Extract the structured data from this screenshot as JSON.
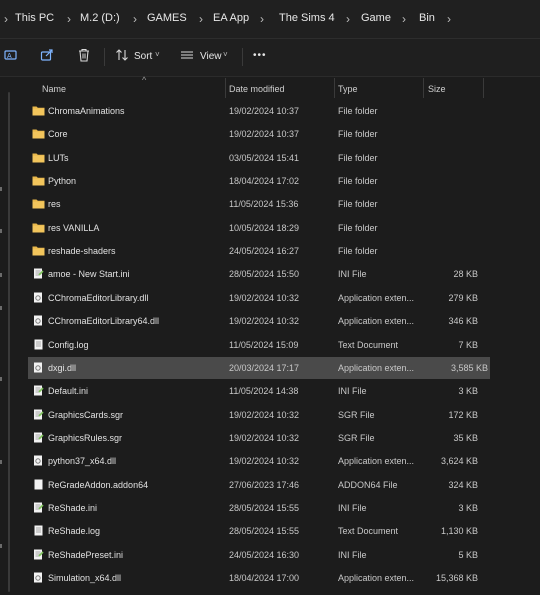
{
  "breadcrumb": {
    "items": [
      "This PC",
      "M.2 (D:)",
      "GAMES",
      "EA App",
      "The Sims 4",
      "Game",
      "Bin"
    ]
  },
  "toolbar": {
    "sort_label": "Sort",
    "view_label": "View",
    "more_label": "•••"
  },
  "columns": {
    "name": "Name",
    "date": "Date modified",
    "type": "Type",
    "size": "Size"
  },
  "files": [
    {
      "name": "ChromaAnimations",
      "date": "19/02/2024 10:37",
      "type": "File folder",
      "size": "",
      "icon": "folder-icon"
    },
    {
      "name": "Core",
      "date": "19/02/2024 10:37",
      "type": "File folder",
      "size": "",
      "icon": "folder-icon"
    },
    {
      "name": "LUTs",
      "date": "03/05/2024 15:41",
      "type": "File folder",
      "size": "",
      "icon": "folder-icon"
    },
    {
      "name": "Python",
      "date": "18/04/2024 17:02",
      "type": "File folder",
      "size": "",
      "icon": "folder-icon"
    },
    {
      "name": "res",
      "date": "11/05/2024 15:36",
      "type": "File folder",
      "size": "",
      "icon": "folder-icon"
    },
    {
      "name": "res VANILLA",
      "date": "10/05/2024 18:29",
      "type": "File folder",
      "size": "",
      "icon": "folder-icon"
    },
    {
      "name": "reshade-shaders",
      "date": "24/05/2024 16:27",
      "type": "File folder",
      "size": "",
      "icon": "folder-icon"
    },
    {
      "name": "amoe - New Start.ini",
      "date": "28/05/2024 15:50",
      "type": "INI File",
      "size": "28 KB",
      "icon": "ini-file-icon"
    },
    {
      "name": "CChromaEditorLibrary.dll",
      "date": "19/02/2024 10:32",
      "type": "Application exten...",
      "size": "279 KB",
      "icon": "dll-file-icon"
    },
    {
      "name": "CChromaEditorLibrary64.dll",
      "date": "19/02/2024 10:32",
      "type": "Application exten...",
      "size": "346 KB",
      "icon": "dll-file-icon"
    },
    {
      "name": "Config.log",
      "date": "11/05/2024 15:09",
      "type": "Text Document",
      "size": "7 KB",
      "icon": "text-file-icon"
    },
    {
      "name": "dxgi.dll",
      "date": "20/03/2024 17:17",
      "type": "Application exten...",
      "size": "3,585 KB",
      "icon": "dll-file-icon",
      "selected": true
    },
    {
      "name": "Default.ini",
      "date": "11/05/2024 14:38",
      "type": "INI File",
      "size": "3 KB",
      "icon": "ini-file-icon"
    },
    {
      "name": "GraphicsCards.sgr",
      "date": "19/02/2024 10:32",
      "type": "SGR File",
      "size": "172 KB",
      "icon": "sgr-file-icon"
    },
    {
      "name": "GraphicsRules.sgr",
      "date": "19/02/2024 10:32",
      "type": "SGR File",
      "size": "35 KB",
      "icon": "sgr-file-icon"
    },
    {
      "name": "python37_x64.dll",
      "date": "19/02/2024 10:32",
      "type": "Application exten...",
      "size": "3,624 KB",
      "icon": "dll-file-icon"
    },
    {
      "name": "ReGradeAddon.addon64",
      "date": "27/06/2023 17:46",
      "type": "ADDON64 File",
      "size": "324 KB",
      "icon": "generic-file-icon"
    },
    {
      "name": "ReShade.ini",
      "date": "28/05/2024 15:55",
      "type": "INI File",
      "size": "3 KB",
      "icon": "ini-file-icon"
    },
    {
      "name": "ReShade.log",
      "date": "28/05/2024 15:55",
      "type": "Text Document",
      "size": "1,130 KB",
      "icon": "text-file-icon"
    },
    {
      "name": "ReShadePreset.ini",
      "date": "24/05/2024 16:30",
      "type": "INI File",
      "size": "5 KB",
      "icon": "ini-file-icon"
    },
    {
      "name": "Simulation_x64.dll",
      "date": "18/04/2024 17:00",
      "type": "Application exten...",
      "size": "15,368 KB",
      "icon": "dll-file-icon"
    }
  ],
  "colors": {
    "background": "#1c1c1c",
    "selected_row": "#4a4a4a",
    "folder": "#e8b74a",
    "accent": "#7fb5ff"
  }
}
